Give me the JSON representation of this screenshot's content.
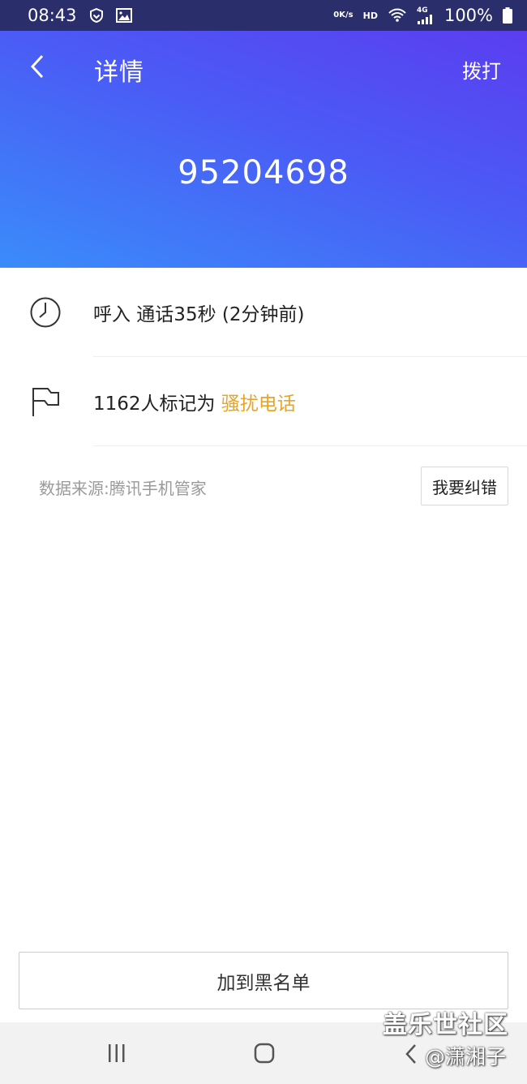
{
  "status_bar": {
    "time": "08:43",
    "speed_value": "0",
    "speed_unit": "K/s",
    "hd": "HD",
    "network": "4G",
    "battery": "100%"
  },
  "header": {
    "title": "详情",
    "dial_label": "拨打",
    "phone_number": "95204698"
  },
  "call_info": {
    "text": "呼入 通话35秒  (2分钟前)"
  },
  "mark_info": {
    "prefix": "1162人标记为 ",
    "tag": "骚扰电话"
  },
  "source": {
    "label": "数据来源:",
    "provider": "腾讯手机管家",
    "correct_label": "我要纠错"
  },
  "actions": {
    "blacklist_label": "加到黑名单"
  },
  "watermark": {
    "line1": "盖乐世社区",
    "line2": "@潇湘子"
  },
  "colors": {
    "header_gradient_start": "#5b3df0",
    "header_gradient_end": "#3a8cfa",
    "harass_tag": "#e8a426",
    "status_bar": "#2a2e6b"
  }
}
